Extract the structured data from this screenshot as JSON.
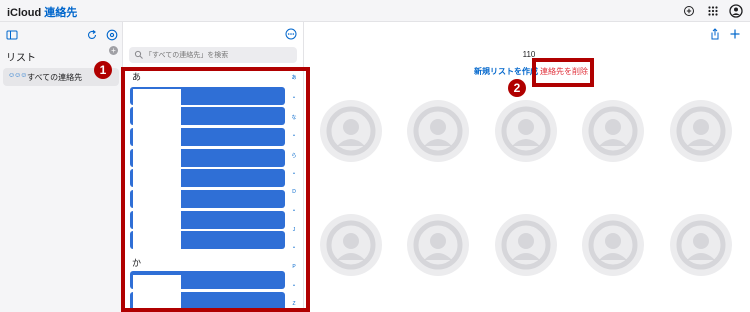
{
  "header": {
    "apple_logo": "",
    "brand": "iCloud",
    "app_name": "連絡先",
    "icons": [
      "add-circle-icon",
      "app-grid-icon",
      "account-icon"
    ]
  },
  "sidebar": {
    "icons": [
      "sidebar-toggle-icon",
      "refresh-icon",
      "settings-icon"
    ],
    "list_heading": "リスト",
    "add_list_icon": "plus-icon",
    "items": [
      {
        "icon": "people-icon",
        "label": "すべての連絡先"
      }
    ]
  },
  "contact_list": {
    "more_icon": "ellipsis-icon",
    "search_placeholder": "「すべての連絡先」を検索",
    "sections": [
      {
        "header": "あ",
        "rows": 8
      },
      {
        "header": "か",
        "rows": 2
      }
    ],
    "index": [
      "あ",
      "•",
      "な",
      "•",
      "ら",
      "•",
      "D",
      "•",
      "J",
      "•",
      "P",
      "•",
      "Z"
    ]
  },
  "main": {
    "icons": [
      "share-icon",
      "plus-icon"
    ],
    "count": "110",
    "new_list_label": "新規リストを作成",
    "delete_label": "連絡先を削除",
    "avatar_count": 10
  },
  "annotations": {
    "color": "#b00000",
    "badges": [
      "1",
      "2"
    ]
  }
}
